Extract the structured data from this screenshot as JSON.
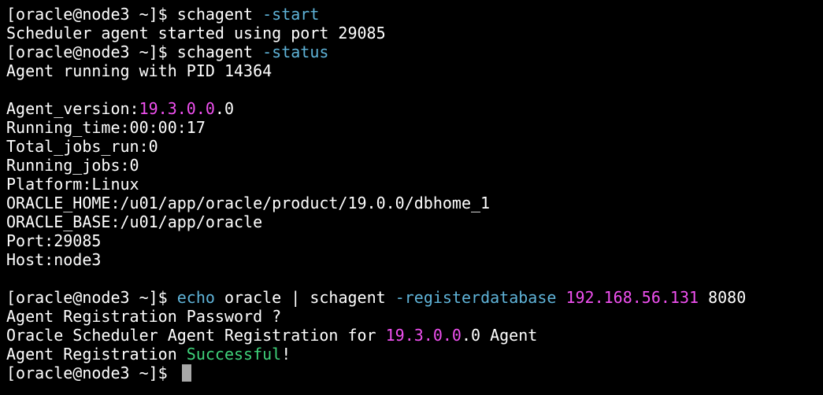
{
  "terminal": {
    "colors": {
      "background": "#000000",
      "text": "#ffffff",
      "option": "#5fb3d8",
      "number": "#f050f0",
      "success": "#3fd27a",
      "cursor": "#a8a8a8"
    },
    "lines": [
      [
        {
          "text": "[oracle@node3 ~]$ schagent ",
          "color": "default"
        },
        {
          "text": "-start",
          "color": "cyan"
        }
      ],
      [
        {
          "text": "Scheduler agent started using port 29085",
          "color": "default"
        }
      ],
      [
        {
          "text": "[oracle@node3 ~]$ schagent ",
          "color": "default"
        },
        {
          "text": "-status",
          "color": "cyan"
        }
      ],
      [
        {
          "text": "Agent running with PID 14364",
          "color": "default"
        }
      ],
      [],
      [
        {
          "text": "Agent_version:",
          "color": "default"
        },
        {
          "text": "19.3.0.0",
          "color": "magenta"
        },
        {
          "text": ".0",
          "color": "default"
        }
      ],
      [
        {
          "text": "Running_time:00:00:17",
          "color": "default"
        }
      ],
      [
        {
          "text": "Total_jobs_run:0",
          "color": "default"
        }
      ],
      [
        {
          "text": "Running_jobs:0",
          "color": "default"
        }
      ],
      [
        {
          "text": "Platform:Linux",
          "color": "default"
        }
      ],
      [
        {
          "text": "ORACLE_HOME:/u01/app/oracle/product/19.0.0/dbhome_1",
          "color": "default"
        }
      ],
      [
        {
          "text": "ORACLE_BASE:/u01/app/oracle",
          "color": "default"
        }
      ],
      [
        {
          "text": "Port:29085",
          "color": "default"
        }
      ],
      [
        {
          "text": "Host:node3",
          "color": "default"
        }
      ],
      [],
      [
        {
          "text": "[oracle@node3 ~]$ ",
          "color": "default"
        },
        {
          "text": "echo",
          "color": "cyan"
        },
        {
          "text": " oracle | schagent ",
          "color": "default"
        },
        {
          "text": "-registerdatabase",
          "color": "cyan"
        },
        {
          "text": " ",
          "color": "default"
        },
        {
          "text": "192.168.56.131",
          "color": "magenta"
        },
        {
          "text": " 8080",
          "color": "default"
        }
      ],
      [
        {
          "text": "Agent Registration Password ?",
          "color": "default"
        }
      ],
      [
        {
          "text": "Oracle Scheduler Agent Registration for ",
          "color": "default"
        },
        {
          "text": "19.3.0.0",
          "color": "magenta"
        },
        {
          "text": ".0 Agent",
          "color": "default"
        }
      ],
      [
        {
          "text": "Agent Registration ",
          "color": "default"
        },
        {
          "text": "Successful",
          "color": "green"
        },
        {
          "text": "!",
          "color": "default"
        }
      ],
      [
        {
          "text": "[oracle@node3 ~]$ ",
          "color": "default"
        }
      ]
    ],
    "cursor_line": 19
  }
}
